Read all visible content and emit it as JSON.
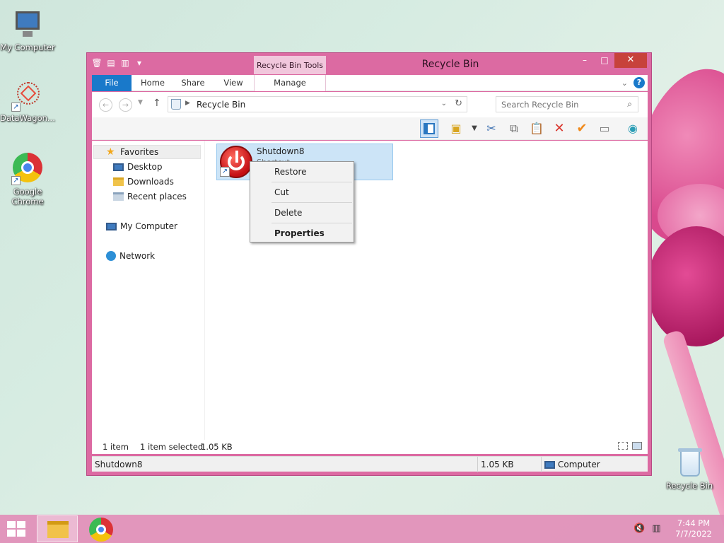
{
  "desktop": {
    "icons": [
      {
        "label": "My Computer"
      },
      {
        "label": "DataWagon..."
      },
      {
        "label": "Google Chrome"
      },
      {
        "label": "Recycle Bin"
      }
    ]
  },
  "window": {
    "title": "Recycle Bin",
    "context_tab_header": "Recycle Bin Tools",
    "controls": {
      "minimize": "–",
      "maximize": "□",
      "close": "✕"
    },
    "ribbon_tabs": [
      "File",
      "Home",
      "Share",
      "View",
      "Manage"
    ],
    "address": {
      "path": "Recycle Bin"
    },
    "search": {
      "placeholder": "Search Recycle Bin"
    },
    "nav_pane": {
      "favorites": "Favorites",
      "desktop": "Desktop",
      "downloads": "Downloads",
      "recent": "Recent places",
      "computer": "My Computer",
      "network": "Network"
    },
    "files": [
      {
        "name": "Shutdown8",
        "type": "Shortcut"
      }
    ],
    "status": {
      "count": "1 item",
      "selected": "1 item selected",
      "size": "1.05 KB"
    },
    "details_bar": {
      "name": "Shutdown8",
      "size": "1.05 KB",
      "location": "Computer"
    }
  },
  "context_menu": {
    "items": [
      "Restore",
      "Cut",
      "Delete",
      "Properties"
    ]
  },
  "taskbar": {
    "time": "7:44 PM",
    "date": "7/7/2022"
  },
  "colors": {
    "window_frame": "#dc6aa2",
    "file_tab": "#1979ca",
    "selection": "#cce4f7",
    "close_button": "#c7423b"
  }
}
